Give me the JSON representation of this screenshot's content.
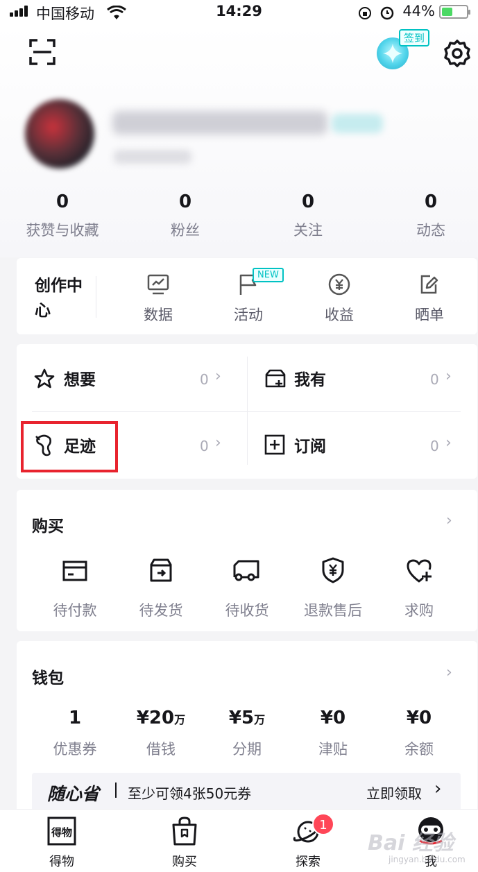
{
  "status_bar": {
    "carrier": "中国移动",
    "time": "14:29",
    "battery": "44%",
    "battery_level": 0.44
  },
  "header": {
    "sign_in_label": "签到"
  },
  "stats": [
    {
      "value": "0",
      "label": "获赞与收藏"
    },
    {
      "value": "0",
      "label": "粉丝"
    },
    {
      "value": "0",
      "label": "关注"
    },
    {
      "value": "0",
      "label": "动态"
    }
  ],
  "creator_center": {
    "title": "创作中心",
    "items": [
      {
        "label": "数据",
        "icon": "chart-icon"
      },
      {
        "label": "活动",
        "icon": "flag-icon",
        "badge": "NEW"
      },
      {
        "label": "收益",
        "icon": "yen-coin-icon"
      },
      {
        "label": "晒单",
        "icon": "edit-icon"
      }
    ]
  },
  "favorites": [
    {
      "label": "想要",
      "count": "0",
      "icon": "star-icon"
    },
    {
      "label": "我有",
      "count": "0",
      "icon": "cart-add-icon"
    },
    {
      "label": "足迹",
      "count": "0",
      "icon": "footprint-icon"
    },
    {
      "label": "订阅",
      "count": "0",
      "icon": "plus-square-icon"
    }
  ],
  "purchase": {
    "title": "购买",
    "items": [
      {
        "label": "待付款",
        "icon": "card-icon"
      },
      {
        "label": "待发货",
        "icon": "box-icon"
      },
      {
        "label": "待收货",
        "icon": "truck-icon"
      },
      {
        "label": "退款售后",
        "icon": "shield-yen-icon"
      },
      {
        "label": "求购",
        "icon": "heart-plus-icon"
      }
    ]
  },
  "wallet": {
    "title": "钱包",
    "items": [
      {
        "value": "1",
        "unit": "",
        "label": "优惠券"
      },
      {
        "value": "¥20",
        "unit": "万",
        "label": "借钱"
      },
      {
        "value": "¥5",
        "unit": "万",
        "label": "分期"
      },
      {
        "value": "¥0",
        "unit": "",
        "label": "津贴"
      },
      {
        "value": "¥0",
        "unit": "",
        "label": "余额"
      }
    ],
    "promo": {
      "brand": "随心省",
      "text": "至少可领4张50元券",
      "action": "立即领取"
    }
  },
  "tabbar": {
    "items": [
      {
        "label": "得物",
        "icon_text": "得物"
      },
      {
        "label": "购买"
      },
      {
        "label": "探索",
        "badge": "1"
      },
      {
        "label": "我"
      }
    ]
  },
  "watermark": {
    "text": "Bai 经验",
    "sub": "jingyan.baidu.com"
  },
  "colors": {
    "accent": "#01c2c3",
    "highlight": "#e8232e",
    "badge": "#ff4657"
  }
}
